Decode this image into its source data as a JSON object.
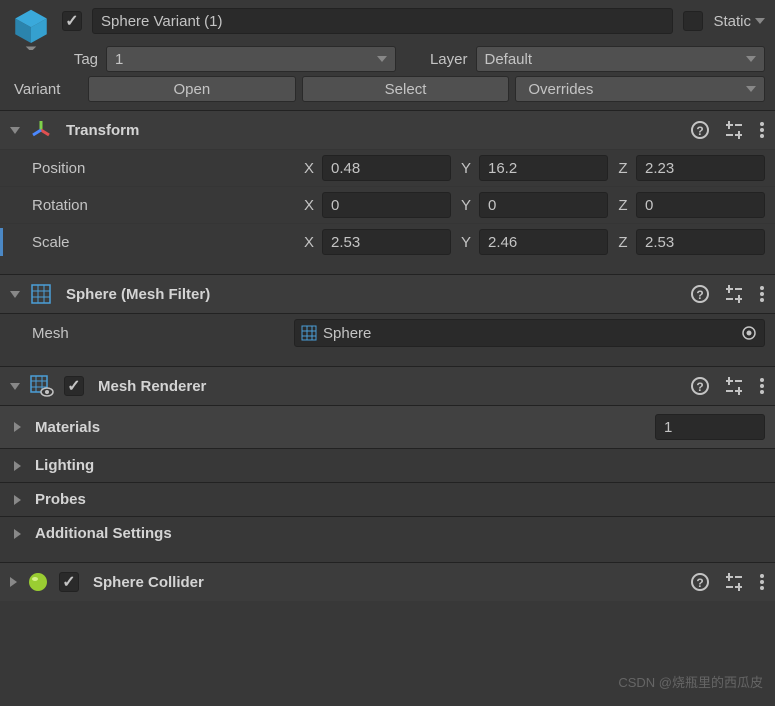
{
  "header": {
    "name": "Sphere Variant (1)",
    "static_label": "Static",
    "tag_label": "Tag",
    "tag_value": "1",
    "layer_label": "Layer",
    "layer_value": "Default",
    "variant_label": "Variant",
    "open_btn": "Open",
    "select_btn": "Select",
    "overrides_btn": "Overrides"
  },
  "transform": {
    "title": "Transform",
    "position_label": "Position",
    "rotation_label": "Rotation",
    "scale_label": "Scale",
    "x": "X",
    "y": "Y",
    "z": "Z",
    "position": {
      "x": "0.48",
      "y": "16.2",
      "z": "2.23"
    },
    "rotation": {
      "x": "0",
      "y": "0",
      "z": "0"
    },
    "scale": {
      "x": "2.53",
      "y": "2.46",
      "z": "2.53"
    }
  },
  "meshFilter": {
    "title": "Sphere (Mesh Filter)",
    "mesh_label": "Mesh",
    "mesh_value": "Sphere"
  },
  "meshRenderer": {
    "title": "Mesh Renderer",
    "materials_label": "Materials",
    "materials_count": "1",
    "lighting_label": "Lighting",
    "probes_label": "Probes",
    "additional_label": "Additional Settings"
  },
  "sphereCollider": {
    "title": "Sphere Collider"
  },
  "watermark": "CSDN @烧瓶里的西瓜皮"
}
